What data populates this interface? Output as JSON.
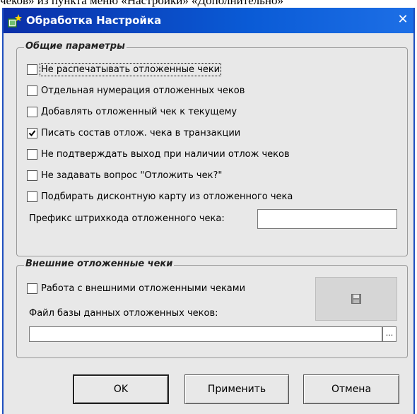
{
  "document": {
    "top_text": "чеков» из пункта меню «Настройки» «Дополнительно»"
  },
  "window": {
    "title": "Обработка  Настройка",
    "close_label": "✕"
  },
  "general": {
    "legend": "Общие параметры",
    "options": [
      {
        "label": "Не распечатывать отложенные чеки",
        "checked": false
      },
      {
        "label": "Отдельная нумерация отложенных чеков",
        "checked": false
      },
      {
        "label": "Добавлять отложенный чек к текущему",
        "checked": false
      },
      {
        "label": "Писать состав отлож. чека в транзакции",
        "checked": true
      },
      {
        "label": "Не подтверждать выход при наличии отлож чеков",
        "checked": false
      },
      {
        "label": "Не задавать вопрос \"Отложить чек?\"",
        "checked": false
      },
      {
        "label": "Подбирать дисконтную карту из отложенного чека",
        "checked": false
      }
    ],
    "prefix_label": "Префикс штрихкода отложенного чека:",
    "prefix_value": ""
  },
  "external": {
    "legend": "Внешние отложенные чеки",
    "option": {
      "label": "Работа с внешними отложенными чеками",
      "checked": false
    },
    "db_file_label": "Файл базы данных отложенных чеков:",
    "db_file_value": "",
    "browse_label": "...",
    "save_icon": "floppy-disk-icon"
  },
  "buttons": {
    "ok": "OK",
    "apply": "Применить",
    "cancel": "Отмена"
  },
  "colors": {
    "titlebar": "#0a2fa8",
    "window_bg": "#e8e8e8"
  }
}
